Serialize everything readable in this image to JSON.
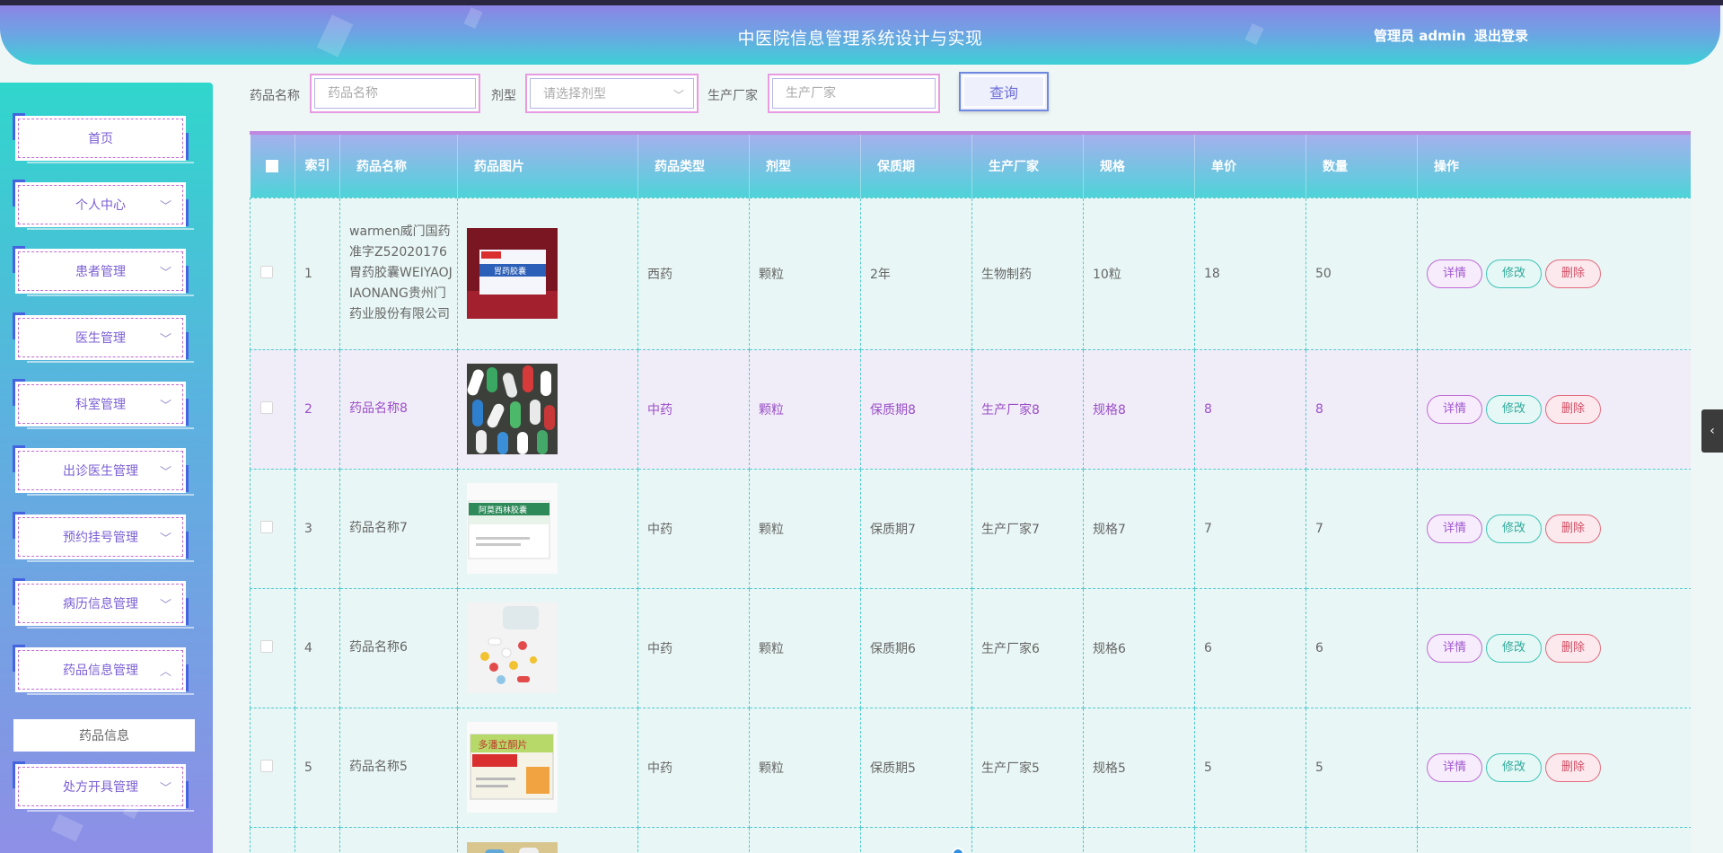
{
  "header": {
    "title": "中医院信息管理系统设计与实现",
    "user": "管理员 admin",
    "logout": "退出登录"
  },
  "sidebar": {
    "items": [
      {
        "label": "首页",
        "chevron": ""
      },
      {
        "label": "个人中心",
        "chevron": "﹀"
      },
      {
        "label": "患者管理",
        "chevron": "﹀"
      },
      {
        "label": "医生管理",
        "chevron": "﹀"
      },
      {
        "label": "科室管理",
        "chevron": "﹀"
      },
      {
        "label": "出诊医生管理",
        "chevron": "﹀"
      },
      {
        "label": "预约挂号管理",
        "chevron": "﹀"
      },
      {
        "label": "病历信息管理",
        "chevron": "﹀"
      },
      {
        "label": "药品信息管理",
        "chevron": "︿"
      },
      {
        "label": "处方开具管理",
        "chevron": "﹀"
      }
    ],
    "submenu": {
      "label": "药品信息"
    }
  },
  "search": {
    "name_label": "药品名称",
    "name_placeholder": "药品名称",
    "form_label": "剂型",
    "form_placeholder": "请选择剂型",
    "maker_label": "生产厂家",
    "maker_placeholder": "生产厂家",
    "button": "查询"
  },
  "table": {
    "headers": {
      "index": "索引",
      "name": "药品名称",
      "image": "药品图片",
      "type": "药品类型",
      "form": "剂型",
      "shelf": "保质期",
      "maker": "生产厂家",
      "spec": "规格",
      "price": "单价",
      "qty": "数量",
      "ops": "操作"
    },
    "rows": [
      {
        "index": "1",
        "name": "warmen威门国药准字Z52020176胃药胶囊WEIYAOJIAONANG贵州门药业股份有限公司",
        "image": "stomach-capsule-box",
        "type": "西药",
        "form": "颗粒",
        "shelf": "2年",
        "maker": "生物制药",
        "spec": "10粒",
        "price": "18",
        "qty": "50"
      },
      {
        "index": "2",
        "name": "药品名称8",
        "image": "colorful-capsules",
        "type": "中药",
        "form": "颗粒",
        "shelf": "保质期8",
        "maker": "生产厂家8",
        "spec": "规格8",
        "price": "8",
        "qty": "8"
      },
      {
        "index": "3",
        "name": "药品名称7",
        "image": "amoxicillin-box",
        "type": "中药",
        "form": "颗粒",
        "shelf": "保质期7",
        "maker": "生产厂家7",
        "spec": "规格7",
        "price": "7",
        "qty": "7"
      },
      {
        "index": "4",
        "name": "药品名称6",
        "image": "scattered-pills",
        "type": "中药",
        "form": "颗粒",
        "shelf": "保质期6",
        "maker": "生产厂家6",
        "spec": "规格6",
        "price": "6",
        "qty": "6"
      },
      {
        "index": "5",
        "name": "药品名称5",
        "image": "domperidone-box",
        "type": "中药",
        "form": "颗粒",
        "shelf": "保质期5",
        "maker": "生产厂家5",
        "spec": "规格5",
        "price": "5",
        "qty": "5"
      }
    ],
    "actions": {
      "detail": "详情",
      "edit": "修改",
      "delete": "删除"
    }
  },
  "side_tab": {
    "icon": "‹"
  }
}
